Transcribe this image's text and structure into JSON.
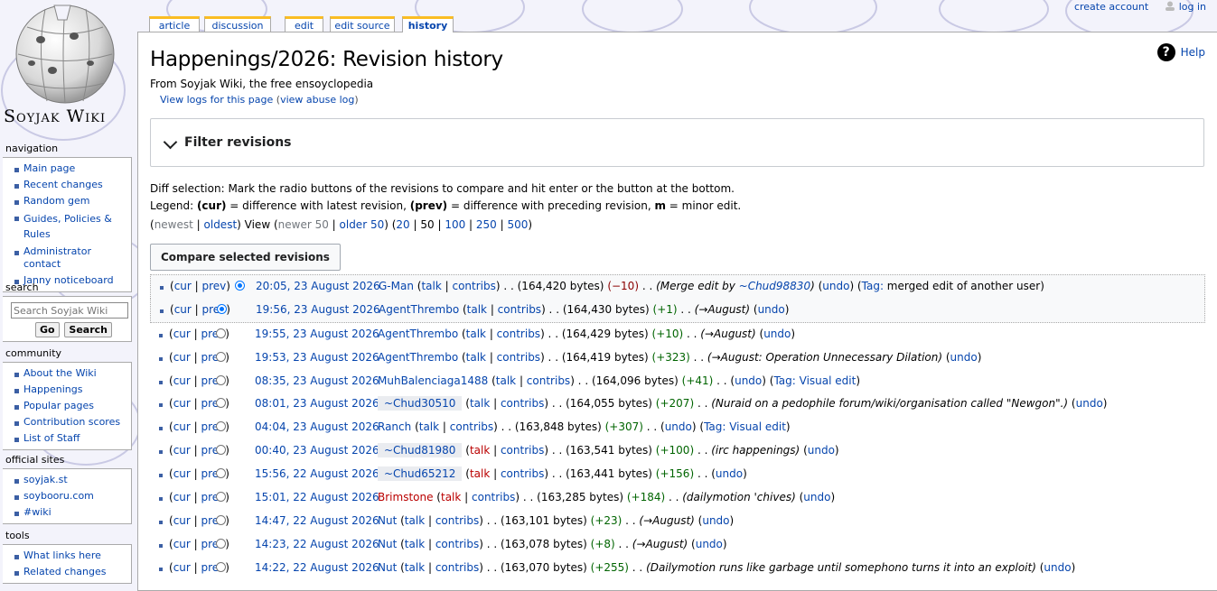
{
  "logo": {
    "site_name": "Soyjak Wiki"
  },
  "personal": {
    "create_account": "create account",
    "log_in": "log in"
  },
  "tabs": [
    {
      "label": "article"
    },
    {
      "label": "discussion"
    },
    {
      "label": "edit"
    },
    {
      "label": "edit source"
    },
    {
      "label": "history"
    }
  ],
  "sidebar": {
    "navigation": {
      "title": "navigation",
      "items": [
        "Main page",
        "Recent changes",
        "Random gem",
        "Guides, Policies &",
        "Rules",
        "Administrator contact",
        "Janny noticeboard"
      ]
    },
    "search": {
      "title": "search",
      "placeholder": "Search Soyjak Wiki",
      "go": "Go",
      "search": "Search"
    },
    "community": {
      "title": "community",
      "items": [
        "About the Wiki",
        "Happenings",
        "Popular pages",
        "Contribution scores",
        "List of Staff"
      ]
    },
    "official_sites": {
      "title": "official sites",
      "items": [
        "soyjak.st",
        "soybooru.com",
        "#wiki"
      ]
    },
    "tools": {
      "title": "tools",
      "items": [
        "What links here",
        "Related changes"
      ]
    }
  },
  "page": {
    "title": "Happenings/2026: Revision history",
    "help": "Help",
    "site_sub": "From Soyjak Wiki, the free ensoyclopedia",
    "content_sub": {
      "prefix": "View logs for this page",
      "open": " (",
      "link": "view abuse log",
      "close": ")"
    },
    "filter": "Filter revisions",
    "diff_line1": "Diff selection: Mark the radio buttons of the revisions to compare and hit enter or the button at the bottom.",
    "legend": {
      "prefix": "Legend: ",
      "cur": "(cur)",
      "t1": " = difference with latest revision, ",
      "prev": "(prev)",
      "t2": " = difference with preceding revision, ",
      "m": "m",
      "t3": " = minor edit."
    },
    "nav": {
      "newest": "newest",
      "oldest": "oldest",
      "view": "View",
      "newer": "newer 50",
      "older": "older 50",
      "limits": [
        "20",
        "50",
        "100",
        "250",
        "500"
      ]
    },
    "compare_button": "Compare selected revisions"
  },
  "revisions": [
    {
      "cur": "cur",
      "prev": "prev",
      "date": "20:05, 23 August 2026",
      "user": "G-Man",
      "user_style": "normal",
      "talk": "talk",
      "contribs": "contribs",
      "bytes": "(164,420 bytes)",
      "diff": "(−10)",
      "diff_sign": "neg",
      "comment": "(Merge edit by ",
      "comment_link": "~Chud98830",
      "comment_end": ")",
      "undo": "undo",
      "tag_prefix": "Tag: ",
      "tag_link": "",
      "tag_text": "merged edit of another user",
      "radio": "r1on"
    },
    {
      "cur": "cur",
      "prev": "prev",
      "date": "19:56, 23 August 2026",
      "user": "AgentThrembo",
      "user_style": "normal",
      "talk": "talk",
      "contribs": "contribs",
      "bytes": "(164,430 bytes)",
      "diff": "(+1)",
      "diff_sign": "pos",
      "comment": "(→August)",
      "comment_link": "",
      "comment_end": "",
      "undo": "undo",
      "tag_prefix": "",
      "tag_link": "",
      "tag_text": "",
      "radio": "r2on"
    },
    {
      "cur": "cur",
      "prev": "prev",
      "date": "19:55, 23 August 2026",
      "user": "AgentThrembo",
      "user_style": "normal",
      "talk": "talk",
      "contribs": "contribs",
      "bytes": "(164,429 bytes)",
      "diff": "(+10)",
      "diff_sign": "pos",
      "comment": "(→August)",
      "comment_link": "",
      "comment_end": "",
      "undo": "undo",
      "tag_prefix": "",
      "tag_link": "",
      "tag_text": "",
      "radio": "r2"
    },
    {
      "cur": "cur",
      "prev": "prev",
      "date": "19:53, 23 August 2026",
      "user": "AgentThrembo",
      "user_style": "normal",
      "talk": "talk",
      "contribs": "contribs",
      "bytes": "(164,419 bytes)",
      "diff": "(+323)",
      "diff_sign": "pos",
      "comment": "(→August: Operation Unnecessary Dilation)",
      "comment_link": "",
      "comment_end": "",
      "undo": "undo",
      "tag_prefix": "",
      "tag_link": "",
      "tag_text": "",
      "radio": "r2"
    },
    {
      "cur": "cur",
      "prev": "prev",
      "date": "08:35, 23 August 2026",
      "user": "MuhBalenciaga1488",
      "user_style": "normal",
      "talk": "talk",
      "contribs": "contribs",
      "bytes": "(164,096 bytes)",
      "diff": "(+41)",
      "diff_sign": "pos",
      "comment": "",
      "comment_link": "",
      "comment_end": "",
      "undo": "undo",
      "tag_prefix": "Tag: ",
      "tag_link": "Visual edit",
      "tag_text": "",
      "radio": "r2"
    },
    {
      "cur": "cur",
      "prev": "prev",
      "date": "08:01, 23 August 2026",
      "user": "~Chud30510",
      "user_style": "anon",
      "talk": "talk",
      "contribs": "contribs",
      "bytes": "(164,055 bytes)",
      "diff": "(+207)",
      "diff_sign": "pos",
      "comment": "(Nuraid on a pedophile forum/wiki/organisation called \"Newgon\".)",
      "comment_link": "",
      "comment_end": "",
      "undo": "undo",
      "tag_prefix": "",
      "tag_link": "",
      "tag_text": "",
      "radio": "r2"
    },
    {
      "cur": "cur",
      "prev": "prev",
      "date": "04:04, 23 August 2026",
      "user": "Ranch",
      "user_style": "normal",
      "talk": "talk",
      "contribs": "contribs",
      "bytes": "(163,848 bytes)",
      "diff": "(+307)",
      "diff_sign": "pos",
      "comment": "",
      "comment_link": "",
      "comment_end": "",
      "undo": "undo",
      "tag_prefix": "Tag: ",
      "tag_link": "Visual edit",
      "tag_text": "",
      "radio": "r2"
    },
    {
      "cur": "cur",
      "prev": "prev",
      "date": "00:40, 23 August 2026",
      "user": "~Chud81980",
      "user_style": "anon",
      "talk": "talk",
      "talk_red": true,
      "contribs": "contribs",
      "bytes": "(163,541 bytes)",
      "diff": "(+100)",
      "diff_sign": "pos",
      "comment": "(irc happenings)",
      "comment_link": "",
      "comment_end": "",
      "undo": "undo",
      "tag_prefix": "",
      "tag_link": "",
      "tag_text": "",
      "radio": "r2"
    },
    {
      "cur": "cur",
      "prev": "prev",
      "date": "15:56, 22 August 2026",
      "user": "~Chud65212",
      "user_style": "anon",
      "talk": "talk",
      "talk_red": true,
      "contribs": "contribs",
      "bytes": "(163,441 bytes)",
      "diff": "(+156)",
      "diff_sign": "pos",
      "comment": "",
      "comment_link": "",
      "comment_end": "",
      "undo": "undo",
      "tag_prefix": "",
      "tag_link": "",
      "tag_text": "",
      "radio": "r2"
    },
    {
      "cur": "cur",
      "prev": "prev",
      "date": "15:01, 22 August 2026",
      "user": "Brimstone",
      "user_style": "red",
      "talk": "talk",
      "talk_red": true,
      "contribs": "contribs",
      "bytes": "(163,285 bytes)",
      "diff": "(+184)",
      "diff_sign": "pos",
      "comment": "(dailymotion 'chives)",
      "comment_link": "",
      "comment_end": "",
      "undo": "undo",
      "tag_prefix": "",
      "tag_link": "",
      "tag_text": "",
      "radio": "r2"
    },
    {
      "cur": "cur",
      "prev": "prev",
      "date": "14:47, 22 August 2026",
      "user": "Nut",
      "user_style": "normal",
      "talk": "talk",
      "contribs": "contribs",
      "bytes": "(163,101 bytes)",
      "diff": "(+23)",
      "diff_sign": "pos",
      "comment": "(→August)",
      "comment_link": "",
      "comment_end": "",
      "undo": "undo",
      "tag_prefix": "",
      "tag_link": "",
      "tag_text": "",
      "radio": "r2"
    },
    {
      "cur": "cur",
      "prev": "prev",
      "date": "14:23, 22 August 2026",
      "user": "Nut",
      "user_style": "normal",
      "talk": "talk",
      "contribs": "contribs",
      "bytes": "(163,078 bytes)",
      "diff": "(+8)",
      "diff_sign": "pos",
      "comment": "(→August)",
      "comment_link": "",
      "comment_end": "",
      "undo": "undo",
      "tag_prefix": "",
      "tag_link": "",
      "tag_text": "",
      "radio": "r2"
    },
    {
      "cur": "cur",
      "prev": "prev",
      "date": "14:22, 22 August 2026",
      "user": "Nut",
      "user_style": "normal",
      "talk": "talk",
      "contribs": "contribs",
      "bytes": "(163,070 bytes)",
      "diff": "(+255)",
      "diff_sign": "pos",
      "comment": "(Dailymotion runs like garbage until somephono turns it into an exploit)",
      "comment_link": "",
      "comment_end": "",
      "undo": "undo",
      "tag_prefix": "",
      "tag_link": "",
      "tag_text": "",
      "radio": "r2"
    }
  ],
  "colors": {
    "link": "#0645ad",
    "redlink": "#ba0000",
    "positive": "#006400",
    "negative": "#8b0000",
    "tab_accent": "#fabd23",
    "bullet": "#3b5fa4"
  }
}
